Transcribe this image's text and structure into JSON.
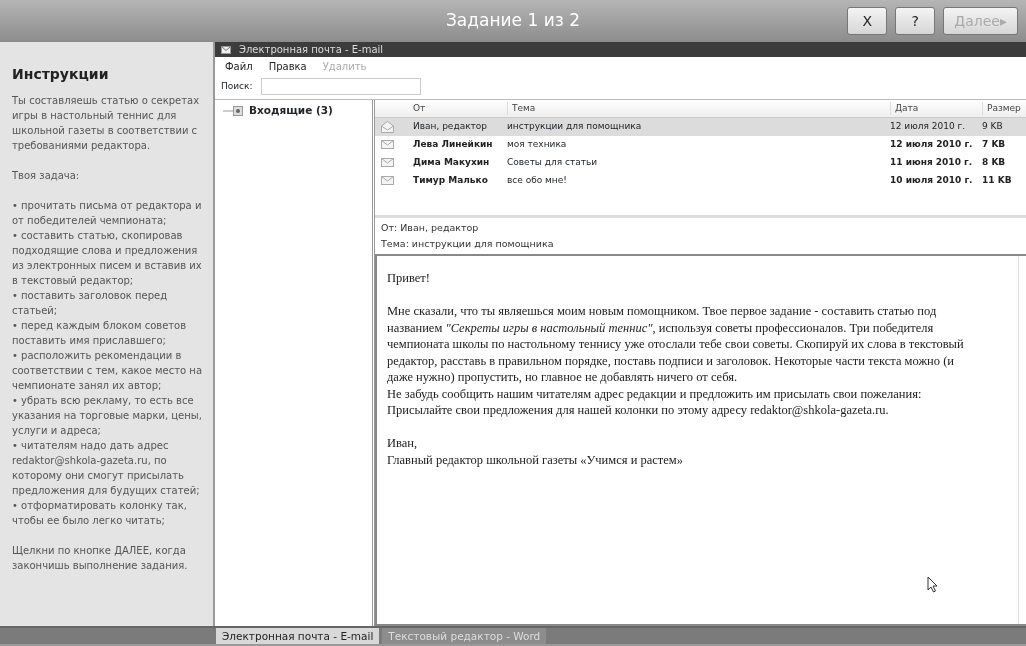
{
  "top_bar": {
    "title": "Задание 1 из 2",
    "buttons": [
      {
        "label": "X",
        "disabled": false
      },
      {
        "label": "?",
        "disabled": false
      },
      {
        "label": "Далее▸",
        "disabled": true
      }
    ]
  },
  "instructions": {
    "title": "Инструкции",
    "blocks": [
      [
        "Ты составляешь статью о секретах игры в настольный теннис для школьной газеты в соответствии с требованиями редактора."
      ],
      [
        "Твоя задача:"
      ],
      [
        "• прочитать письма от редактора и от победителей чемпионата;",
        "• составить статью, скопировав подходящие слова и предложения из электронных писем и вставив их в текстовый редактор;",
        "• поставить заголовок перед статьей;",
        "• перед каждым блоком советов поставить имя приславшего;",
        "• расположить рекомендации в соответствии с тем, какое место на чемпионате занял их автор;",
        "• убрать всю рекламу, то есть все указания на торговые марки, цены, услуги и адреса;",
        "• читателям надо дать адрес redaktor@shkola-gazeta.ru, по которому они смогут присылать предложения для будущих статей;",
        "• отформатировать колонку так, чтобы ее было легко читать;"
      ],
      [
        "Щелкни по кнопке ДАЛЕЕ, когда закончишь выполнение задания."
      ]
    ]
  },
  "email_window": {
    "title": "Электронная почта - E-mail",
    "menu": [
      {
        "label": "Файл",
        "disabled": false
      },
      {
        "label": "Правка",
        "disabled": false
      },
      {
        "label": "Удалить",
        "disabled": true
      }
    ],
    "search": {
      "label": "Поиск:"
    },
    "folders": [
      {
        "label": "Входящие (3)",
        "selected": true
      }
    ],
    "columns": [
      "От",
      "Тема",
      "Дата",
      "Размер"
    ],
    "messages": [
      {
        "from": "Иван, редактор",
        "subject": "инструкции для помощника",
        "date": "12 июля 2010 г.",
        "size": "9 KB",
        "unread": false,
        "selected": true
      },
      {
        "from": "Лева Линейкин",
        "subject": "моя техника",
        "date": "12 июля 2010 г.",
        "size": "7 KB",
        "unread": true,
        "selected": false
      },
      {
        "from": "Дима Макухин",
        "subject": "Советы для статьи",
        "date": "11 июня 2010 г.",
        "size": "8 KB",
        "unread": true,
        "selected": false
      },
      {
        "from": "Тимур Малько",
        "subject": "все обо мне!",
        "date": "10 июля 2010 г.",
        "size": "11 KB",
        "unread": true,
        "selected": false
      }
    ],
    "preview_header": [
      "От: Иван, редактор",
      "Тема: инструкции для помощника"
    ],
    "body": [
      [
        "Привет!"
      ],
      [
        "Мне сказали, что ты являешься моим новым помощником. Твое первое задание - составить статью под названием *\"Секреты игры в настольный теннис\"*, используя советы профессионалов. Три победителя чемпионата школы по настольному теннису уже отослали тебе свои советы. Скопируй их слова в текстовый редактор, расставь в правильном порядке, поставь подписи и заголовок. Некоторые части текста можно (и даже нужно) пропустить, но главное не добавлять ничего от себя.",
        "Не забудь сообщить нашим читателям адрес редакции и предложить им присылать свои пожелания:",
        "Присылайте свои предложения для нашей колонки по этому адресу redaktor@shkola-gazeta.ru."
      ],
      [
        "Иван,",
        "Главный редактор школьной газеты «Учимся и растем»"
      ]
    ]
  },
  "taskbar": [
    {
      "label": "Электронная почта - E-mail",
      "selected": true
    },
    {
      "label": "Текстовый редактор - Word",
      "selected": false
    }
  ]
}
